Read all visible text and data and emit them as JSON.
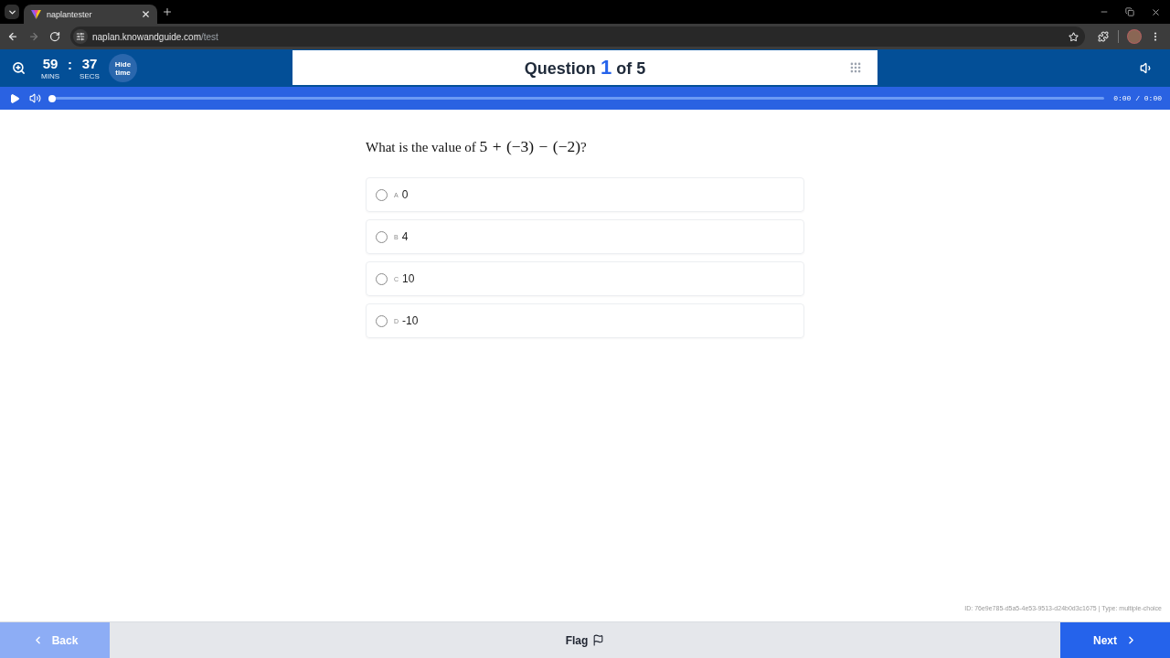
{
  "browser": {
    "tab": {
      "title": "naplantester"
    },
    "address": {
      "host": "naplan.knowandguide.com",
      "path": "/test"
    }
  },
  "header": {
    "timer": {
      "minutes": "59",
      "minutes_label": "MINS",
      "separator": ":",
      "seconds": "37",
      "seconds_label": "SECS"
    },
    "hide_time_button": "Hide time",
    "question_counter": {
      "label": "Question",
      "current": "1",
      "suffix": "of 5"
    }
  },
  "audio_player": {
    "progress": {
      "level": 0
    },
    "time": "0:00 / 0:00"
  },
  "question": {
    "text": "What is the value of",
    "math": "5 + (−3) − (−2)",
    "end": "?"
  },
  "options": [
    {
      "letter": "A",
      "text": "0",
      "selected": false
    },
    {
      "letter": "B",
      "text": "4",
      "selected": false
    },
    {
      "letter": "C",
      "text": "10",
      "selected": false
    },
    {
      "letter": "D",
      "text": "-10",
      "selected": false
    }
  ],
  "meta": "ID: 76e9e785-d5a5-4e53-9513-d24b0d3c1675 | Type: multiple-choice",
  "footer": {
    "back": {
      "label": "Back",
      "disabled": true
    },
    "flag": {
      "label": "Flag"
    },
    "next": {
      "label": "Next"
    }
  }
}
